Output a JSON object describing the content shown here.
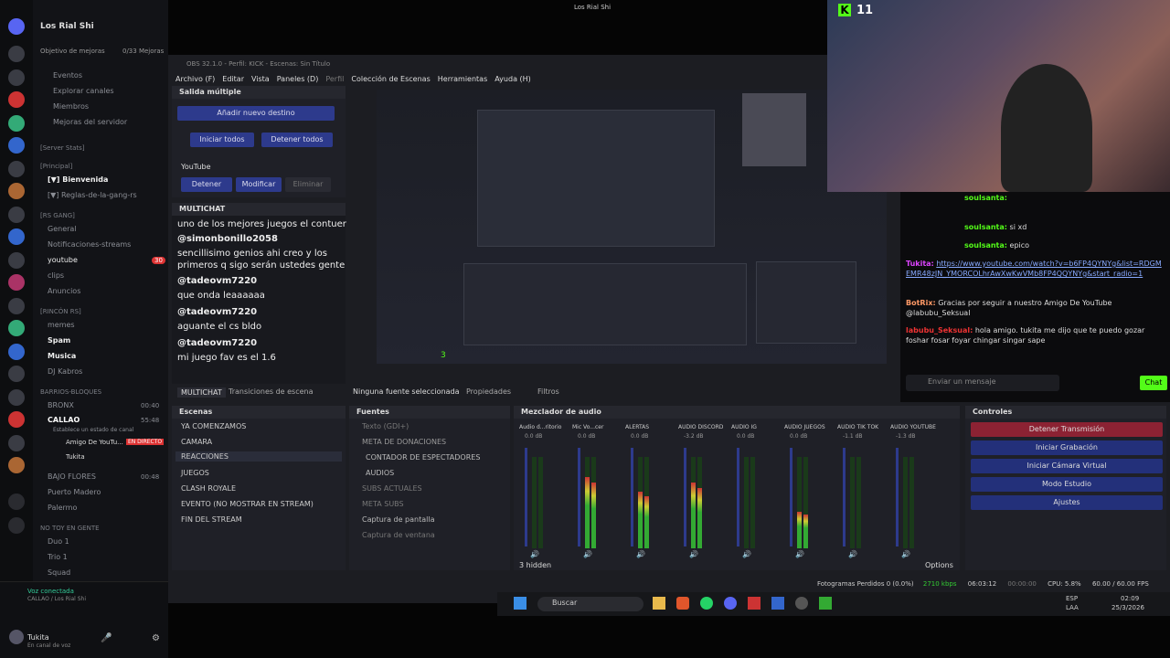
{
  "discord": {
    "server_name": "Los Rial Shi",
    "boost_goal": "Objetivo de mejoras",
    "boost_count": "0/33 Mejoras",
    "top_items": [
      "Eventos",
      "Explorar canales",
      "Miembros",
      "Mejoras del servidor"
    ],
    "categories": [
      "[Server Stats]",
      "[Principal]",
      "[RS GANG]",
      "[RINCÓN RS]",
      "BARRIOS-BLOQUES",
      "NO TOY EN GENTE"
    ],
    "channels_principal": [
      "[▼] Bienvenida",
      "[▼] Reglas-de-la-gang-rs"
    ],
    "channels_gang": [
      "General",
      "Notificaciones-streams",
      "youtube",
      "clips",
      "Anuncios"
    ],
    "youtube_badge": "30",
    "channels_rincon": [
      "memes",
      "Spam",
      "Musica",
      "DJ Kabros"
    ],
    "channels_barrios": [
      "BRONX",
      "CALLAO",
      "BAJO FLORES",
      "Puerto Madero",
      "Palermo"
    ],
    "bronx_time": "00:40",
    "callao_time": "55:48",
    "callao_status": "Establece un estado de canal",
    "callao_members": [
      "Amigo De YouTu...",
      "Tukita"
    ],
    "live_badge": "EN DIRECTO",
    "bajo_time": "00:48",
    "channels_notoy": [
      "Duo 1",
      "Trio 1",
      "Squad"
    ],
    "voice_status": "Voz conectada",
    "voice_channel": "CALLAO / Los Rial Shi",
    "user_name": "Tukita",
    "user_status": "En canal de voz"
  },
  "window_title": "Los Rial Shi",
  "obs": {
    "title": "OBS 32.1.0 - Perfil: KICK - Escenas: Sin Título",
    "menu": [
      "Archivo (F)",
      "Editar",
      "Vista",
      "Paneles (D)",
      "Perfil",
      "Colección de Escenas",
      "Herramientas",
      "Ayuda (H)"
    ],
    "multi_title": "Salida múltiple",
    "add_dest": "Añadir nuevo destino",
    "start_all": "Iniciar todos",
    "stop_all": "Detener todos",
    "youtube": "YouTube",
    "stop": "Detener",
    "modify": "Modificar",
    "remove": "Eliminar",
    "multichat_title": "MULTICHAT",
    "chat_lines": [
      "uno de los mejores juegos el contuer",
      "@simonbonillo2058",
      "sencillisimo genios ahi creo y los",
      "primeros q sigo serán ustedes gente",
      "@tadeovm7220",
      "que onda leaaaaaa",
      "@tadeovm7220",
      "aguante el cs bldo",
      "@tadeovm7220",
      "mi juego fav es el 1.6"
    ],
    "tab_multichat": "MULTICHAT",
    "tab_transitions": "Transiciones de escena",
    "no_source": "Ninguna fuente seleccionada",
    "properties": "Propiedades",
    "filters": "Filtros",
    "scenes_title": "Escenas",
    "scenes": [
      "YA COMENZAMOS",
      "CAMARA",
      "REACCIONES",
      "JUEGOS",
      "CLASH ROYALE",
      "EVENTO (NO MOSTRAR EN STREAM)",
      "FIN DEL STREAM"
    ],
    "sources_title": "Fuentes",
    "sources": [
      "Texto (GDI+)",
      "META DE DONACIONES",
      "CONTADOR DE ESPECTADORES",
      "AUDIOS",
      "SUBS ACTUALES",
      "META SUBS",
      "Captura de pantalla",
      "Captura de ventana"
    ],
    "mixer_title": "Mezclador de audio",
    "channels": [
      {
        "name": "Audio d...ritorio",
        "db": "0.0 dB",
        "level": 0.0
      },
      {
        "name": "Mic Vo...cer",
        "db": "0.0 dB",
        "level": 0.78
      },
      {
        "name": "ALERTAS",
        "db": "0.0 dB",
        "level": 0.62
      },
      {
        "name": "AUDIO DISCORD",
        "db": "-3.2 dB",
        "level": 0.72
      },
      {
        "name": "AUDIO IG",
        "db": "0.0 dB",
        "level": 0.0
      },
      {
        "name": "AUDIO JUEGOS",
        "db": "0.0 dB",
        "level": 0.4
      },
      {
        "name": "AUDIO TIK TOK",
        "db": "-1.1 dB",
        "level": 0.0
      },
      {
        "name": "AUDIO YOUTUBE",
        "db": "-1.3 dB",
        "level": 0.0
      }
    ],
    "hidden": "3 hidden",
    "options": "Options",
    "controls_title": "Controles",
    "controls": [
      "Detener Transmisión",
      "Iniciar Grabación",
      "Iniciar Cámara Virtual",
      "Modo Estudio",
      "Ajustes"
    ],
    "status": {
      "dropped": "Fotogramas Perdidos 0 (0.0%)",
      "kbps": "2710 kbps",
      "time": "06:03:12",
      "rec": "00:00:00",
      "cpu": "CPU: 5.8%",
      "fps": "60.00 / 60.00 FPS"
    }
  },
  "kick": {
    "viewers": "11",
    "messages": [
      {
        "user": "soulsanta:",
        "text": ""
      },
      {
        "user": "soulsanta:",
        "text": "si xd"
      },
      {
        "user": "soulsanta:",
        "text": "epico"
      },
      {
        "user": "Tukita:",
        "text": "https://www.youtube.com/watch?v=b6FP4QYNYg&list=RDGMEMR48zJN_YMORCOLhrAwXwKwVMb8FP4QQYNYg&start_radio=1"
      },
      {
        "user": "BotRix:",
        "text": "Gracias por seguir a nuestro Amigo De YouTube @labubu_Seksual"
      },
      {
        "user": "labubu_Seksual:",
        "text": "hola amigo. tukita me dijo que te puedo gozar foshar fosar foyar chingar singar sape"
      }
    ],
    "placeholder": "Enviar un mensaje",
    "chat_button": "Chat",
    "preview_count": "3"
  },
  "taskbar": {
    "search": "Buscar",
    "lang1": "ESP",
    "lang2": "LAA",
    "time": "02:09",
    "date": "25/3/2026"
  },
  "colors": {
    "accent": "#2d3a8c",
    "kick_green": "#53fc18",
    "stop_red": "#8c2233"
  }
}
